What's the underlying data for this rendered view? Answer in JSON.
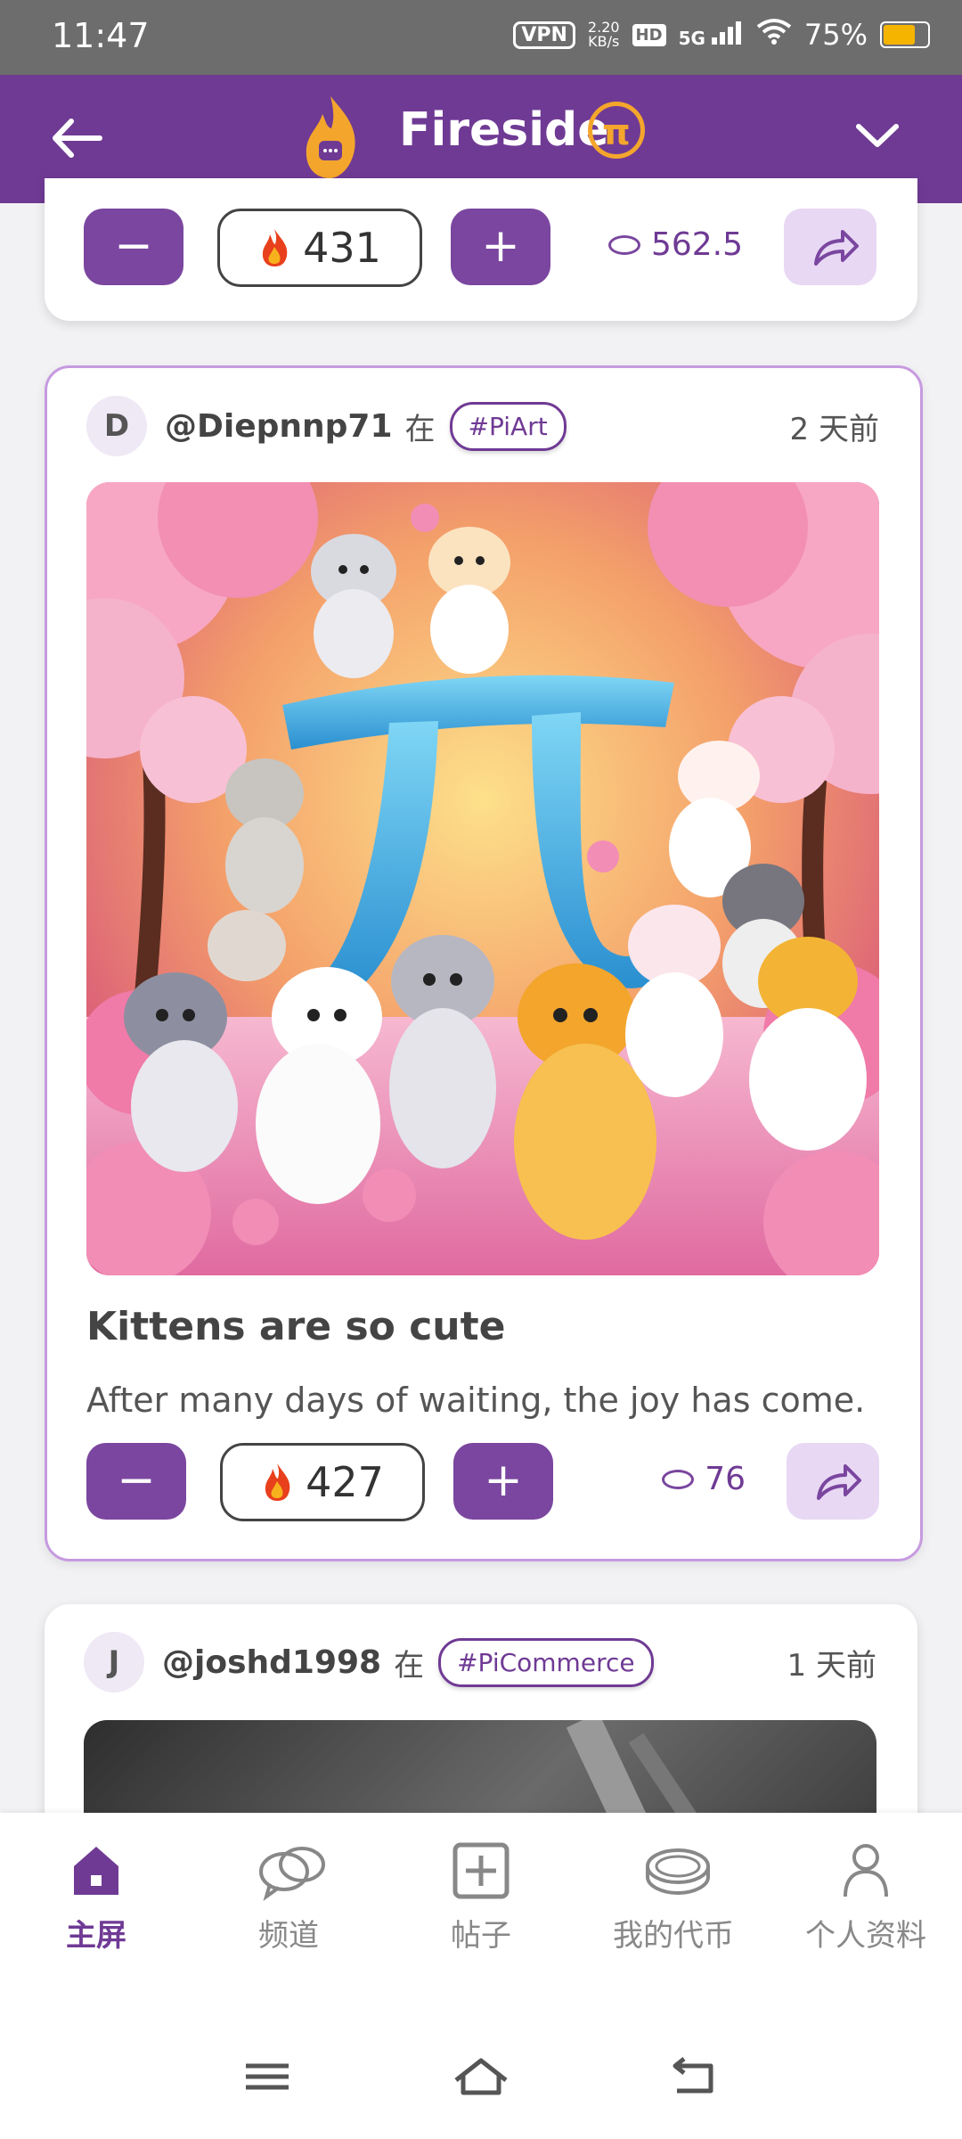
{
  "status_bar": {
    "time": "11:47",
    "vpn": "VPN",
    "net_speed_value": "2.20",
    "net_speed_unit": "KB/s",
    "hd": "HD",
    "signal": "5G",
    "battery": "75%",
    "battery_level": 0.75
  },
  "header": {
    "title": "Fireside",
    "pi_symbol": "π"
  },
  "top_card": {
    "score": "431",
    "coins": "562.5",
    "minus": "−",
    "plus": "+"
  },
  "post1": {
    "avatar": "D",
    "username": "@Diepnnp71",
    "at": "在",
    "channel": "#PiArt",
    "time": "2 天前",
    "title": "Kittens are so cute",
    "body": "After many days of waiting, the joy has come.",
    "score": "427",
    "coins": "76",
    "minus": "−",
    "plus": "+"
  },
  "post2": {
    "avatar": "J",
    "username": "@joshd1998",
    "at": "在",
    "channel": "#PiCommerce",
    "time": "1 天前"
  },
  "bottom_nav": {
    "items": [
      {
        "label": "主屏",
        "icon": "home-icon"
      },
      {
        "label": "频道",
        "icon": "chat-bubbles-icon"
      },
      {
        "label": "帖子",
        "icon": "add-post-icon"
      },
      {
        "label": "我的代币",
        "icon": "coin-icon"
      },
      {
        "label": "个人资料",
        "icon": "person-icon"
      }
    ]
  },
  "colors": {
    "brand_purple": "#6f3a94",
    "accent_orange": "#f4a62c"
  }
}
